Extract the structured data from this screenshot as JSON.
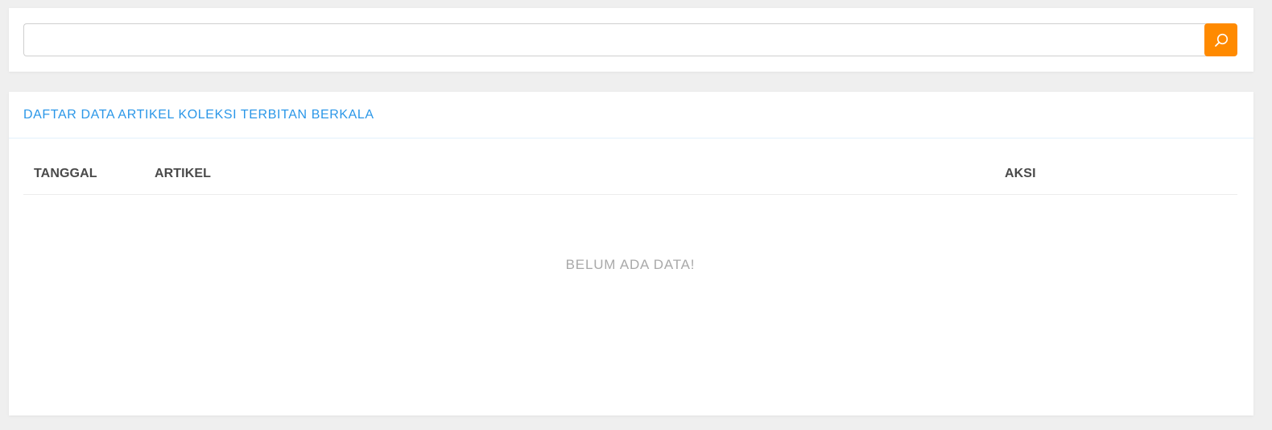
{
  "search": {
    "value": "",
    "placeholder": "",
    "button_icon": "search-icon"
  },
  "colors": {
    "accent": "#ff8a00",
    "title": "#2b97e8",
    "header_text": "#4a4a4a",
    "empty_text": "#a9a9a9"
  },
  "panel": {
    "title": "DAFTAR DATA ARTIKEL KOLEKSI TERBITAN BERKALA"
  },
  "table": {
    "columns": [
      "TANGGAL",
      "ARTIKEL",
      "AKSI"
    ],
    "rows": [],
    "empty_message": "BELUM ADA DATA!"
  }
}
